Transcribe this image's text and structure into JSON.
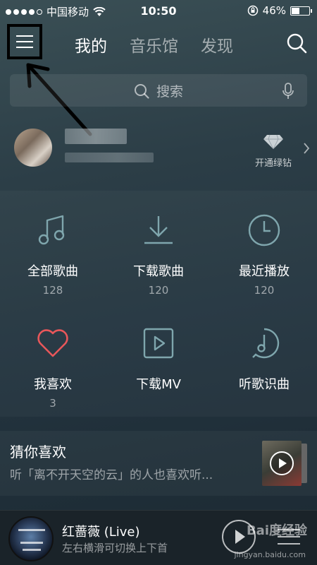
{
  "status_bar": {
    "carrier": "中国移动",
    "time": "10:50",
    "battery_percent": "46%",
    "battery_level": 0.46
  },
  "nav": {
    "tabs": [
      {
        "label": "我的"
      },
      {
        "label": "音乐馆"
      },
      {
        "label": "发现"
      }
    ]
  },
  "search": {
    "placeholder": "搜索"
  },
  "profile": {
    "vip_label": "开通绿钻"
  },
  "grid": [
    {
      "label": "全部歌曲",
      "count": "128",
      "icon": "music-note-icon"
    },
    {
      "label": "下载歌曲",
      "count": "120",
      "icon": "download-icon"
    },
    {
      "label": "最近播放",
      "count": "120",
      "icon": "clock-icon"
    },
    {
      "label": "我喜欢",
      "count": "3",
      "icon": "heart-icon"
    },
    {
      "label": "下载MV",
      "count": "",
      "icon": "video-play-icon"
    },
    {
      "label": "听歌识曲",
      "count": "",
      "icon": "recognize-music-icon"
    }
  ],
  "guess": {
    "title": "猜你喜欢",
    "subtitle": "听「离不开天空的云」的人也喜欢听..."
  },
  "player": {
    "title": "红蔷薇 (Live)",
    "subtitle": "左右横滑可切换上下首"
  },
  "watermark": {
    "text": "Bai度经验",
    "url": "jingyan.baidu.com"
  },
  "colors": {
    "accent_red": "#e8575a",
    "icon_teal": "#7fa6ad"
  }
}
